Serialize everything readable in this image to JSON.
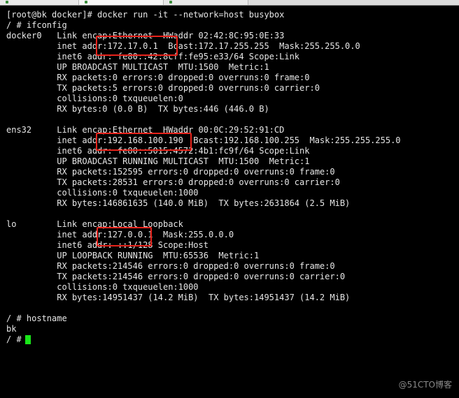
{
  "terminal": {
    "lines": [
      "[root@bk docker]# docker run -it --network=host busybox",
      "/ # ifconfig",
      "docker0   Link encap:Ethernet  HWaddr 02:42:8C:95:0E:33",
      "          inet addr:172.17.0.1  Bcast:172.17.255.255  Mask:255.255.0.0",
      "          inet6 addr: fe80::42:8cff:fe95:e33/64 Scope:Link",
      "          UP BROADCAST MULTICAST  MTU:1500  Metric:1",
      "          RX packets:0 errors:0 dropped:0 overruns:0 frame:0",
      "          TX packets:5 errors:0 dropped:0 overruns:0 carrier:0",
      "          collisions:0 txqueuelen:0",
      "          RX bytes:0 (0.0 B)  TX bytes:446 (446.0 B)",
      "",
      "ens32     Link encap:Ethernet  HWaddr 00:0C:29:52:91:CD",
      "          inet addr:192.168.100.190  Bcast:192.168.100.255  Mask:255.255.255.0",
      "          inet6 addr: fe80::5015:4572:4b1:fc9f/64 Scope:Link",
      "          UP BROADCAST RUNNING MULTICAST  MTU:1500  Metric:1",
      "          RX packets:152595 errors:0 dropped:0 overruns:0 frame:0",
      "          TX packets:28531 errors:0 dropped:0 overruns:0 carrier:0",
      "          collisions:0 txqueuelen:1000",
      "          RX bytes:146861635 (140.0 MiB)  TX bytes:2631864 (2.5 MiB)",
      "",
      "lo        Link encap:Local Loopback",
      "          inet addr:127.0.0.1  Mask:255.0.0.0",
      "          inet6 addr: ::1/128 Scope:Host",
      "          UP LOOPBACK RUNNING  MTU:65536  Metric:1",
      "          RX packets:214546 errors:0 dropped:0 overruns:0 frame:0",
      "          TX packets:214546 errors:0 dropped:0 overruns:0 carrier:0",
      "          collisions:0 txqueuelen:1000",
      "          RX bytes:14951437 (14.2 MiB)  TX bytes:14951437 (14.2 MiB)",
      "",
      "/ # hostname",
      "bk",
      "/ # "
    ]
  },
  "colors": {
    "background": "#000000",
    "text": "#e6e6e6",
    "cursor": "#19e619",
    "highlight_box": "#e8231b"
  },
  "watermark": "@51CTO博客"
}
